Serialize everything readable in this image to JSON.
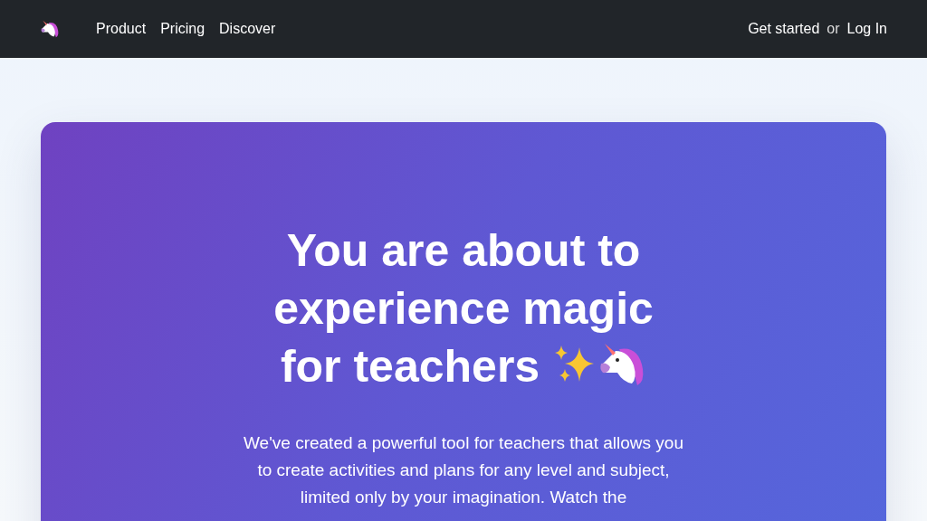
{
  "navbar": {
    "links": [
      {
        "label": "Product"
      },
      {
        "label": "Pricing"
      },
      {
        "label": "Discover"
      }
    ],
    "get_started": "Get started",
    "separator": "or",
    "login": "Log In"
  },
  "hero": {
    "title": "You are about to experience magic for teachers",
    "description": "We've created a powerful tool for teachers that allows you to create activities and plans for any level and subject, limited only by your imagination. Watch the"
  }
}
